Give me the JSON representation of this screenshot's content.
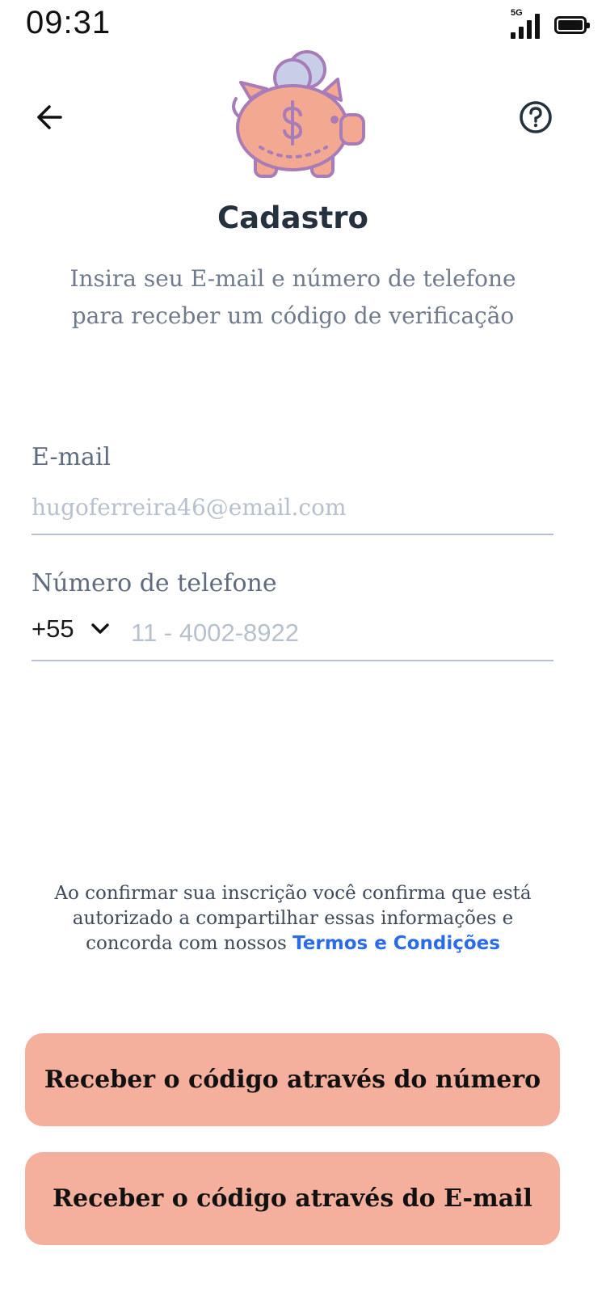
{
  "status_bar": {
    "time": "09:31",
    "network": "5G",
    "icons": [
      "signal-icon",
      "battery-icon"
    ]
  },
  "header": {
    "back_icon": "arrow-left-icon",
    "help_icon": "question-circle-icon",
    "illustration": "piggy-bank-icon"
  },
  "page": {
    "title": "Cadastro",
    "subtitle_line1": "Insira seu E-mail e número de telefone",
    "subtitle_line2": "para receber um código de verificação"
  },
  "form": {
    "email": {
      "label": "E-mail",
      "placeholder": "hugoferreira46@email.com",
      "value": ""
    },
    "phone": {
      "label": "Número de telefone",
      "country_code": "+55",
      "dropdown_icon": "chevron-down-icon",
      "placeholder": "11 - 4002-8922",
      "value": ""
    }
  },
  "terms": {
    "line1": "Ao confirmar sua inscrição você confirma que está",
    "line2": "autorizado a compartilhar essas informações e",
    "line3_prefix": "concorda com nossos ",
    "link": "Termos e Condições"
  },
  "actions": {
    "number_button": "Receber o código através do número",
    "email_button": "Receber o código através do E-mail"
  },
  "colors": {
    "accent": "#f4b09c",
    "link": "#2a6be6",
    "title": "#26313f",
    "muted": "#6f7b8c",
    "piggy_body": "#f3a892",
    "piggy_outline": "#a77cb8",
    "coin": "#c9cee8"
  }
}
